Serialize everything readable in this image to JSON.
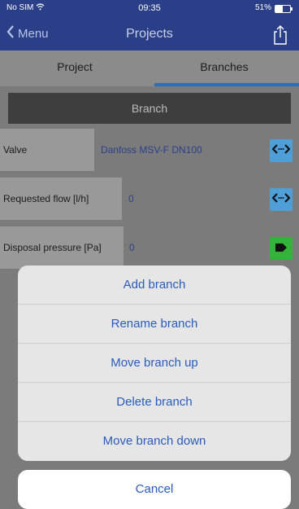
{
  "status_bar": {
    "carrier": "No SIM",
    "time": "09:35",
    "battery": "51%",
    "battery_level": 0.51
  },
  "nav": {
    "back_label": "Menu",
    "title": "Projects",
    "share_icon": "share-icon"
  },
  "tabs": [
    {
      "label": "Project",
      "selected": false
    },
    {
      "label": "Branches",
      "selected": true
    }
  ],
  "branch": {
    "header": "Branch"
  },
  "rows": [
    {
      "label": "Valve",
      "value": "Danfoss MSV-F  DN100",
      "button_icon": "arrows-icon",
      "button_color": "#4e9ed7"
    },
    {
      "label": "Requested flow [l/h]",
      "value": "0",
      "button_icon": "arrows-icon",
      "button_color": "#4e9ed7"
    },
    {
      "label": "Disposal pressure [Pa]",
      "value": "0",
      "button_icon": "tag-icon",
      "button_color": "#32b43a"
    }
  ],
  "action_sheet": {
    "items": [
      "Add branch",
      "Rename branch",
      "Move branch up",
      "Delete branch",
      "Move branch down"
    ],
    "cancel": "Cancel"
  },
  "colors": {
    "nav_bg": "#2b3f88",
    "accent": "#2a5bc0",
    "tab_underline": "#2e6fb6"
  }
}
